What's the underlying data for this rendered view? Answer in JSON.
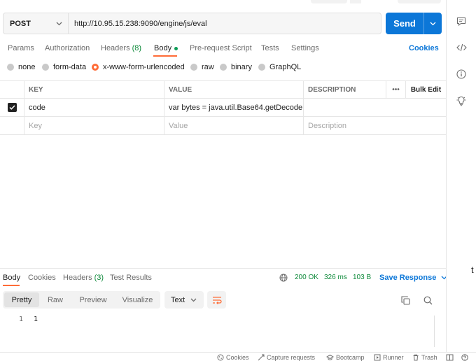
{
  "request": {
    "method": "POST",
    "url": "http://10.95.15.238:9090/engine/js/eval",
    "send_label": "Send"
  },
  "request_tabs": {
    "params": "Params",
    "authorization": "Authorization",
    "headers": "Headers",
    "headers_count": "(8)",
    "body": "Body",
    "pre_request": "Pre-request Script",
    "tests": "Tests",
    "settings": "Settings",
    "cookies": "Cookies"
  },
  "body_types": {
    "none": "none",
    "form_data": "form-data",
    "urlencoded": "x-www-form-urlencoded",
    "raw": "raw",
    "binary": "binary",
    "graphql": "GraphQL",
    "selected": "x-www-form-urlencoded"
  },
  "kv_table": {
    "headers": {
      "key": "KEY",
      "value": "VALUE",
      "description": "DESCRIPTION",
      "more": "•••",
      "bulk_edit": "Bulk Edit"
    },
    "rows": [
      {
        "checked": true,
        "key": "code",
        "value": "var bytes = java.util.Base64.getDecode…",
        "description": ""
      }
    ],
    "placeholders": {
      "key": "Key",
      "value": "Value",
      "description": "Description"
    }
  },
  "response": {
    "tabs": {
      "body": "Body",
      "cookies": "Cookies",
      "headers": "Headers",
      "headers_count": "(3)",
      "test_results": "Test Results"
    },
    "status": "200 OK",
    "time": "326 ms",
    "size": "103 B",
    "save_response": "Save Response",
    "views": {
      "pretty": "Pretty",
      "raw": "Raw",
      "preview": "Preview",
      "visualize": "Visualize",
      "active": "Pretty"
    },
    "format": "Text",
    "lines": [
      {
        "number": "1",
        "text": "1"
      }
    ]
  },
  "status_bar": {
    "cookies": "Cookies",
    "capture": "Capture requests",
    "bootcamp": "Bootcamp",
    "runner": "Runner",
    "trash": "Trash"
  },
  "right_rail": {
    "icons": [
      "comment-icon",
      "code-icon",
      "info-icon",
      "lightbulb-icon"
    ],
    "stray_text": "t"
  },
  "colors": {
    "accent": "#ff6c37",
    "primary": "#0c77d8",
    "success": "#0f8a3b"
  }
}
